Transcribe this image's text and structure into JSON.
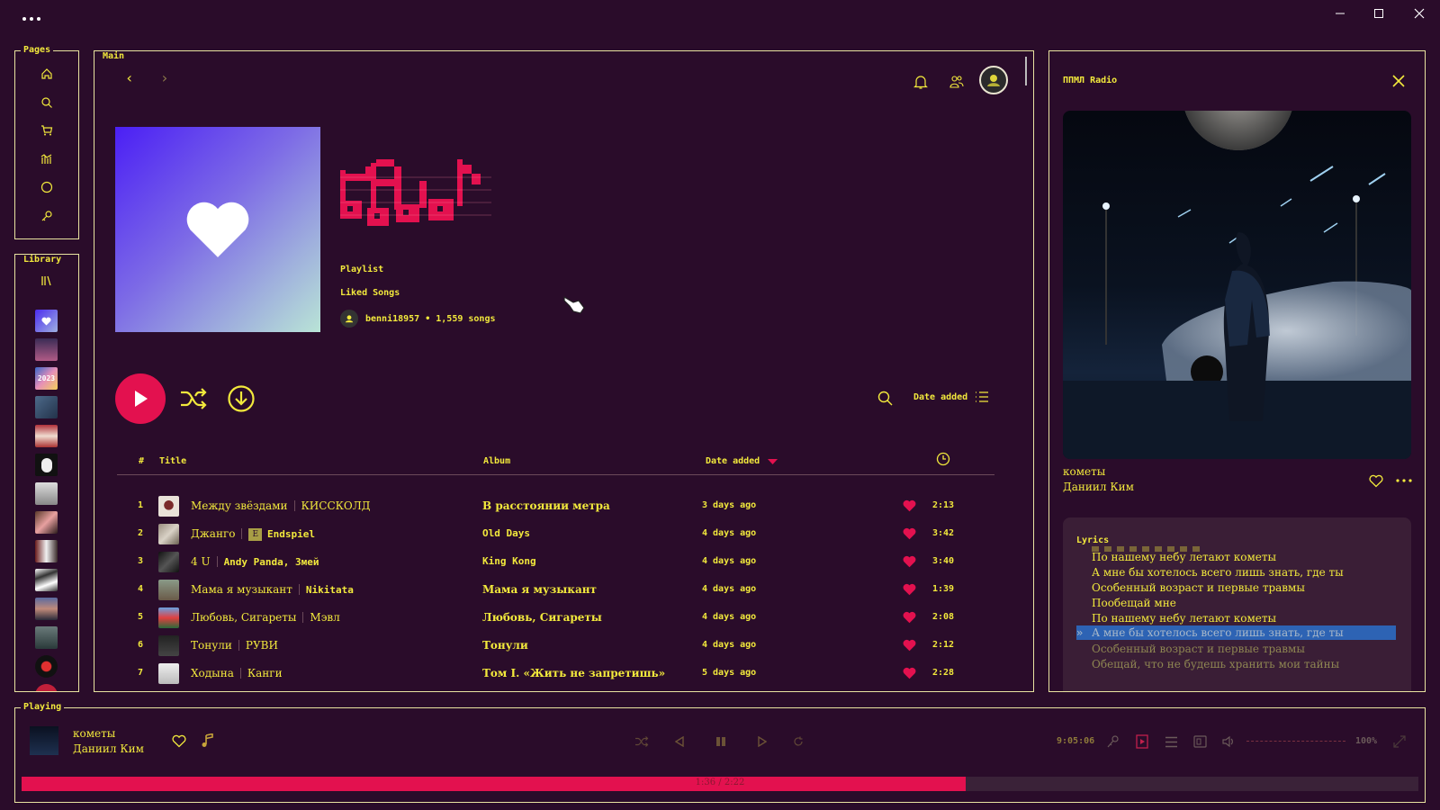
{
  "colors": {
    "background": "#2a0c2a",
    "accent_yellow": "#f2e93c",
    "accent_pink": "#e3114f",
    "border": "#e9e4a0"
  },
  "titlebar": {
    "menu_icon": "ellipsis-icon",
    "minimize_icon": "minimize-icon",
    "maximize_icon": "maximize-icon",
    "close_icon": "close-icon"
  },
  "sidebar": {
    "pages_label": "Pages",
    "pages_icons": [
      "home-icon",
      "search-icon",
      "cart-icon",
      "stats-icon",
      "circle-icon",
      "key-icon"
    ],
    "library_label": "Library",
    "library_icon": "library-icon",
    "library_items": [
      "liked-songs-thumb",
      "playlist-thumb",
      "year-2023-thumb",
      "playlist-thumb",
      "playlist-thumb",
      "playlist-thumb",
      "playlist-thumb",
      "playlist-thumb",
      "playlist-thumb",
      "playlist-thumb",
      "playlist-thumb",
      "playlist-thumb",
      "playlist-thumb",
      "playlist-thumb"
    ],
    "year_thumb_text": "2023"
  },
  "main": {
    "label": "Main",
    "nav_back": "‹",
    "nav_forward": "›",
    "playlist_type": "Playlist",
    "playlist_name": "Liked Songs",
    "owner_line": "benni18957 • 1,559 songs",
    "sort_label": "Date added",
    "columns": {
      "number": "#",
      "title": "Title",
      "album": "Album",
      "date_added": "Date added"
    },
    "tracks": [
      {
        "num": "1",
        "title": "Между звёздами",
        "artist": "КИССКОЛД",
        "album": "В расстоянии метра",
        "album_mono": false,
        "date": "3 days ago",
        "duration": "2:13",
        "explicit": false
      },
      {
        "num": "2",
        "title": "Джанго",
        "artist": "Endspiel",
        "album": "Old Days",
        "album_mono": true,
        "date": "4 days ago",
        "duration": "3:42",
        "explicit": true,
        "explicit_label": "E"
      },
      {
        "num": "3",
        "title": "4 U",
        "artist": "Andy Panda, Змей",
        "album": "King Kong",
        "album_mono": true,
        "date": "4 days ago",
        "duration": "3:40",
        "explicit": false
      },
      {
        "num": "4",
        "title": "Мама я музыкант",
        "artist": "Nikitata",
        "album": "Мама я музыкант",
        "album_mono": false,
        "date": "4 days ago",
        "duration": "1:39",
        "explicit": false
      },
      {
        "num": "5",
        "title": "Любовь, Сигареты",
        "artist": "Мэвл",
        "album": "Любовь, Сигареты",
        "album_mono": false,
        "date": "4 days ago",
        "duration": "2:08",
        "explicit": false
      },
      {
        "num": "6",
        "title": "Тонули",
        "artist": "РУВИ",
        "album": "Тонули",
        "album_mono": false,
        "date": "4 days ago",
        "duration": "2:12",
        "explicit": false
      },
      {
        "num": "7",
        "title": "Ходына",
        "artist": "Канги",
        "album": "Том I. «Жить не запретишь»",
        "album_mono": false,
        "date": "5 days ago",
        "duration": "2:28",
        "explicit": false
      }
    ]
  },
  "right_panel": {
    "title": "ППМЛ Radio",
    "song_title": "кометы",
    "song_artist": "Даниил Ким",
    "lyrics_label": "Lyrics",
    "lyrics": [
      "По нашему небу летают кометы",
      "А мне бы хотелось всего лишь знать, где ты",
      "Особенный возраст и первые травмы",
      "Пообещай мне",
      "По нашему небу летают кометы",
      "А мне бы хотелось всего лишь знать, где ты",
      "Особенный возраст и первые травмы",
      "Обещай, что не будешь хранить мои тайны"
    ],
    "lyrics_active_index": 5,
    "lyrics_active_marker": "»"
  },
  "player": {
    "label": "Playing",
    "song_title": "кометы",
    "song_artist": "Даниил Ким",
    "clock": "9:05:06",
    "volume": "100%",
    "time_display": "1:36 / 2:22",
    "progress_fraction": 0.676
  }
}
